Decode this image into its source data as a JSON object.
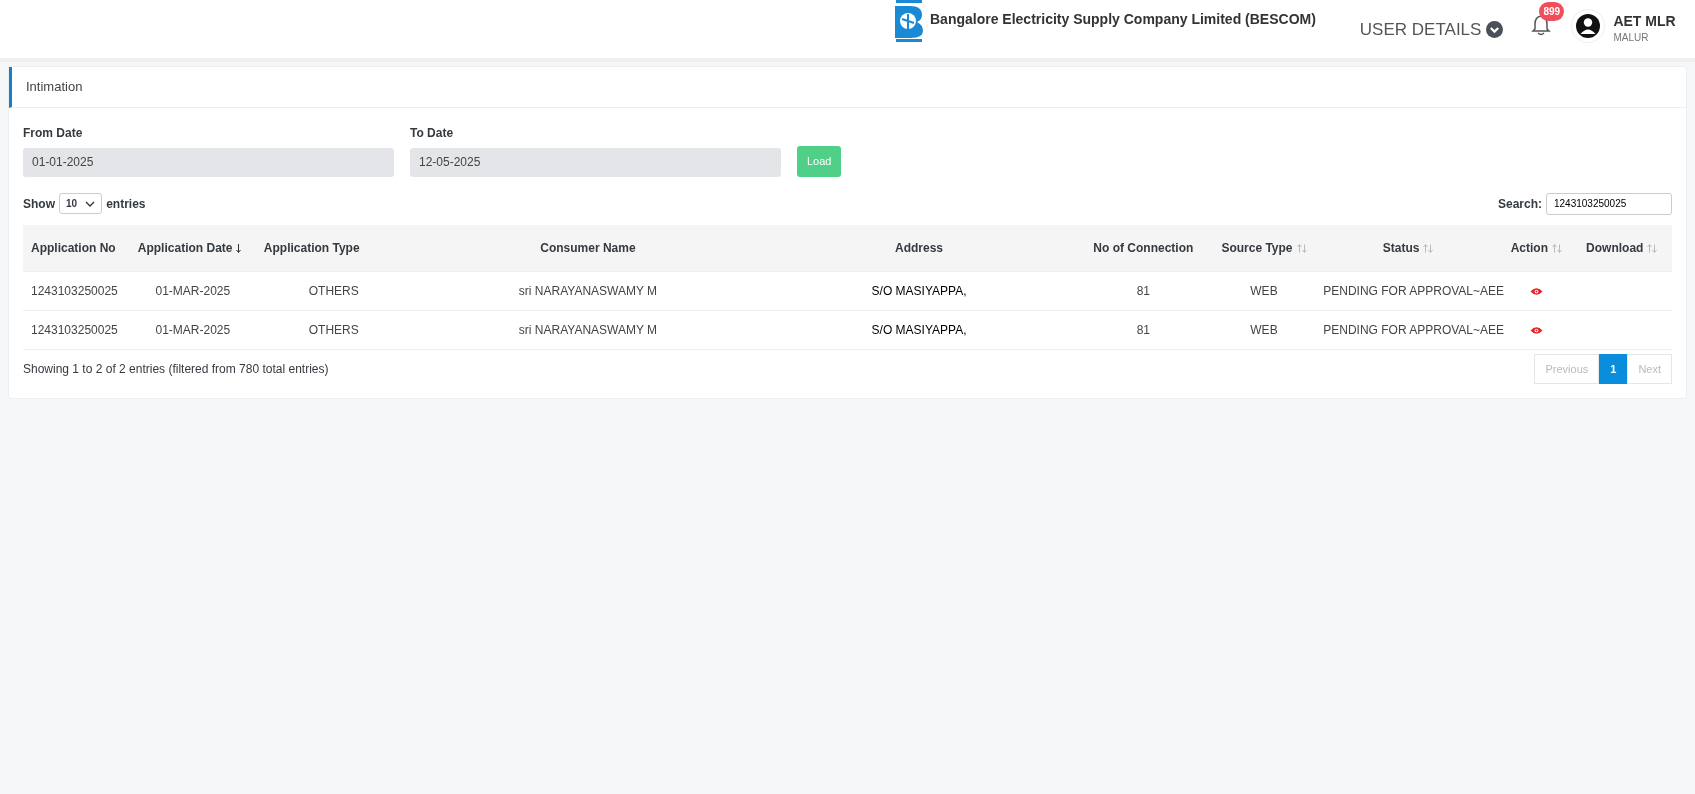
{
  "header": {
    "company": "Bangalore Electricity Supply Company Limited (BESCOM)",
    "user_menu": "USER DETAILS",
    "notification_count": "899",
    "user_name": "AET MLR",
    "user_location": "MALUR"
  },
  "card": {
    "title": "Intimation",
    "filters": [
      {
        "label": "From Date",
        "value": "01-01-2025"
      },
      {
        "label": "To Date",
        "value": "12-05-2025"
      }
    ],
    "load_button": "Load",
    "length": {
      "prefix": "Show",
      "value": "10",
      "suffix": "entries"
    },
    "search": {
      "label": "Search:",
      "value": "1243103250025"
    },
    "table": {
      "columns": [
        {
          "label": "Application No"
        },
        {
          "label": "Application Date",
          "sorted": true
        },
        {
          "label": "Application Type"
        },
        {
          "label": "Consumer Name"
        },
        {
          "label": "Address"
        },
        {
          "label": "No of Connection"
        },
        {
          "label": "Source Type",
          "sorted": false
        },
        {
          "label": "Status",
          "sorted": false
        },
        {
          "label": "Action",
          "sorted": false
        },
        {
          "label": "Download",
          "sorted": false
        }
      ],
      "rows": [
        {
          "cells": [
            "1243103250025",
            "01-MAR-2025",
            "OTHERS",
            "sri NARAYANASWAMY M",
            "S/O MASIYAPPA,",
            "81",
            "WEB",
            "PENDING FOR APPROVAL~AEE"
          ],
          "viewable": true
        },
        {
          "cells": [
            "1243103250025",
            "01-MAR-2025",
            "OTHERS",
            "sri NARAYANASWAMY M",
            "S/O MASIYAPPA,",
            "81",
            "WEB",
            "PENDING FOR APPROVAL~AEE"
          ],
          "viewable": true
        }
      ]
    },
    "info": "Showing 1 to 2 of 2 entries (filtered from 780 total entries)",
    "pagination": [
      {
        "label": "Previous",
        "disabled": true,
        "selected": false
      },
      {
        "label": "1",
        "disabled": false,
        "selected": true
      },
      {
        "label": "Next",
        "disabled": true,
        "selected": false
      }
    ]
  }
}
